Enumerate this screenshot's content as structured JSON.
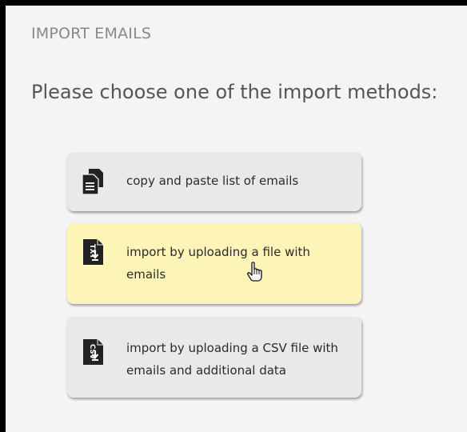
{
  "header": {
    "title": "IMPORT EMAILS",
    "subtitle": "Please choose one of the import methods:"
  },
  "options": [
    {
      "label": "copy and paste list of emails",
      "icon": "copy-paste-icon",
      "state": "normal"
    },
    {
      "label": "import by uploading a file with emails",
      "icon": "txt-file-upload-icon",
      "icon_text": "TXT",
      "state": "hover"
    },
    {
      "label": "import by uploading a CSV file with emails and additional data",
      "icon": "csv-file-upload-icon",
      "icon_text": "CSV",
      "state": "normal"
    }
  ],
  "colors": {
    "background": "#f4f4f4",
    "frame": "#000000",
    "option_background": "#e9e9e9",
    "option_hover_background": "#fdf4b8",
    "icon": "#222222",
    "title_text": "#888888"
  },
  "cursor": "hand-pointer-icon"
}
